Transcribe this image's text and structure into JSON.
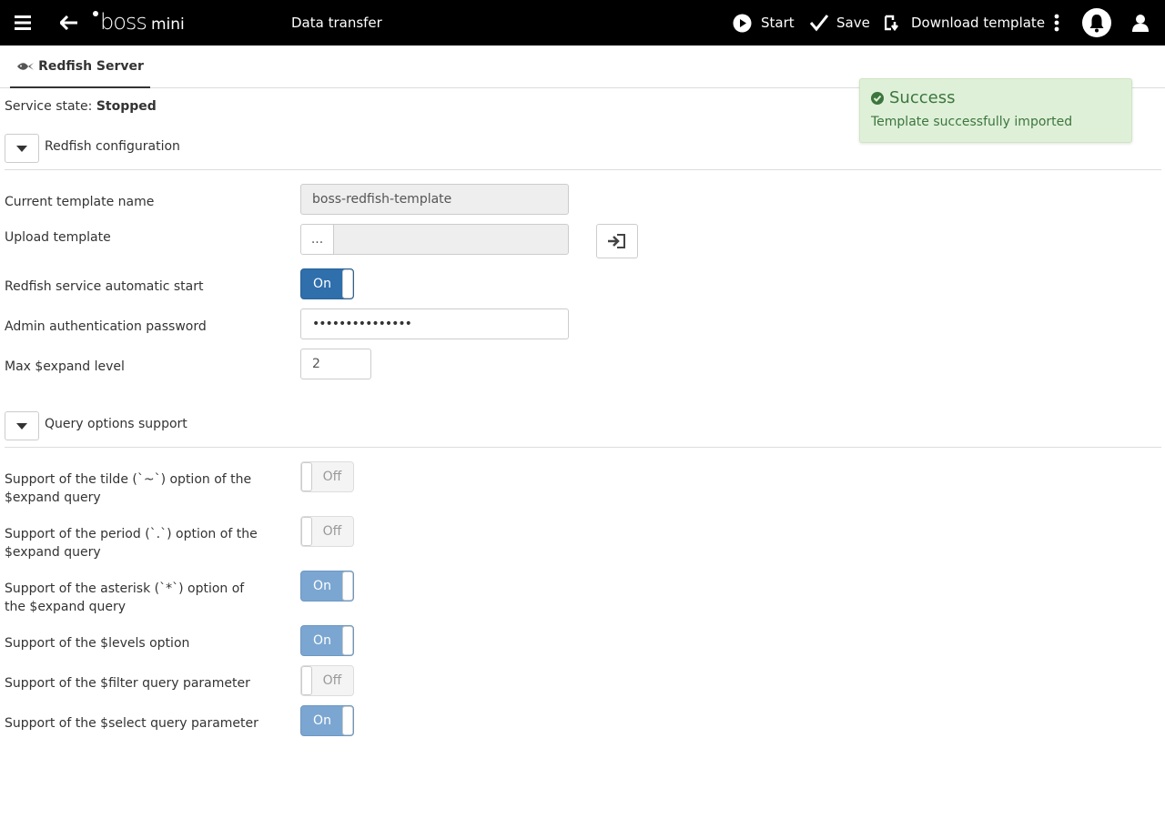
{
  "header": {
    "brand_main": "boss",
    "brand_sub": "mini",
    "page_title": "Data transfer",
    "start_label": "Start",
    "save_label": "Save",
    "download_label": "Download template"
  },
  "tabs": [
    {
      "label": "Redfish Server"
    }
  ],
  "service_state": {
    "label": "Service state:",
    "value": "Stopped"
  },
  "sections": {
    "config": {
      "title": "Redfish configuration",
      "fields": {
        "template_name": {
          "label": "Current template name",
          "value": "boss-redfish-template"
        },
        "upload": {
          "label": "Upload template",
          "browse_label": "..."
        },
        "auto_start": {
          "label": "Redfish service automatic start",
          "state": "On"
        },
        "password": {
          "label": "Admin authentication password",
          "value": "•••••••••••••••"
        },
        "max_expand": {
          "label": "Max $expand level",
          "value": "2"
        }
      }
    },
    "query": {
      "title": "Query options support",
      "options": [
        {
          "label": "Support of the tilde (`~`) option of the $expand query",
          "state": "Off"
        },
        {
          "label": "Support of the period (`.`) option of the $expand query",
          "state": "Off"
        },
        {
          "label": "Support of the asterisk (`*`) option of the $expand query",
          "state": "On"
        },
        {
          "label": "Support of the $levels option",
          "state": "On"
        },
        {
          "label": "Support of the $filter query parameter",
          "state": "Off"
        },
        {
          "label": "Support of the $select query parameter",
          "state": "On"
        }
      ]
    }
  },
  "toast": {
    "title": "Success",
    "message": "Template successfully imported"
  },
  "colors": {
    "header_bg": "#000000",
    "toggle_on": "#2e6fac",
    "toast_bg": "#dff0d8",
    "toast_text": "#3c763d"
  }
}
